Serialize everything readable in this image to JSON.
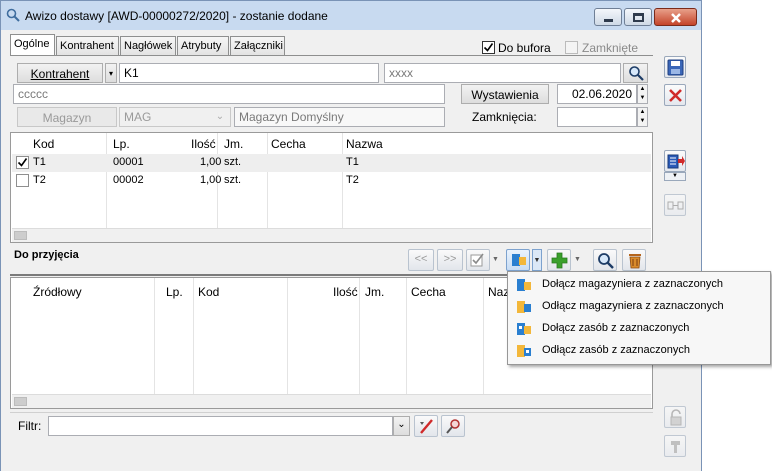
{
  "window": {
    "title": "Awizo dostawy [AWD-00000272/2020]  - zostanie dodane"
  },
  "tabs": [
    {
      "label": "Ogólne"
    },
    {
      "label": "Kontrahent"
    },
    {
      "label": "Nagłówek"
    },
    {
      "label": "Atrybuty"
    },
    {
      "label": "Załączniki"
    }
  ],
  "header": {
    "do_bufora_label": "Do bufora",
    "do_bufora_checked": true,
    "zamkniete_label": "Zamknięte",
    "kontrahent_button": "Kontrahent",
    "kontrahent_code": "K1",
    "kontrahent_name_placeholder": "xxxx",
    "kontrahent_address": "ccccc",
    "wystawienia_button": "Wystawienia",
    "wystawienia_date": "02.06.2020",
    "magazyn_button": "Magazyn",
    "magazyn_code": "MAG",
    "magazyn_name": "Magazyn Domyślny",
    "zamkniecia_label": "Zamknięcia:",
    "zamkniecia_value": ""
  },
  "top_grid": {
    "columns": [
      "Kod",
      "Lp.",
      "Ilość",
      "Jm.",
      "Cecha",
      "Nazwa"
    ],
    "rows": [
      {
        "checked": true,
        "kod": "T1",
        "lp": "00001",
        "ilosc": "1,00",
        "jm": "szt.",
        "cecha": "",
        "nazwa": "T1"
      },
      {
        "checked": false,
        "kod": "T2",
        "lp": "00002",
        "ilosc": "1,00",
        "jm": "szt.",
        "cecha": "",
        "nazwa": "T2"
      }
    ]
  },
  "toolbar": {
    "section_title": "Do przyjęcia",
    "prev_label": "<<",
    "next_label": ">>"
  },
  "bottom_grid": {
    "columns": [
      "Źródłowy",
      "Lp.",
      "Kod",
      "Ilość",
      "Jm.",
      "Cecha",
      "Naz"
    ]
  },
  "context_menu": {
    "items": [
      {
        "label": "Dołącz magazyniera z zaznaczonych",
        "icon": "attach-warehouseman-icon"
      },
      {
        "label": "Odłącz magazyniera z zaznaczonych",
        "icon": "detach-warehouseman-icon"
      },
      {
        "label": "Dołącz zasób z zaznaczonych",
        "icon": "attach-resource-icon"
      },
      {
        "label": "Odłącz zasób z zaznaczonych",
        "icon": "detach-resource-icon"
      }
    ]
  },
  "filter": {
    "label": "Filtr:",
    "value": ""
  },
  "colors": {
    "title_bar": "#c8daf0",
    "close_button": "#c4442a",
    "selected_row": "#eeeeee",
    "accent_blue": "#1f6fc4",
    "accent_red": "#d02a2a",
    "accent_green": "#3aa02c"
  }
}
